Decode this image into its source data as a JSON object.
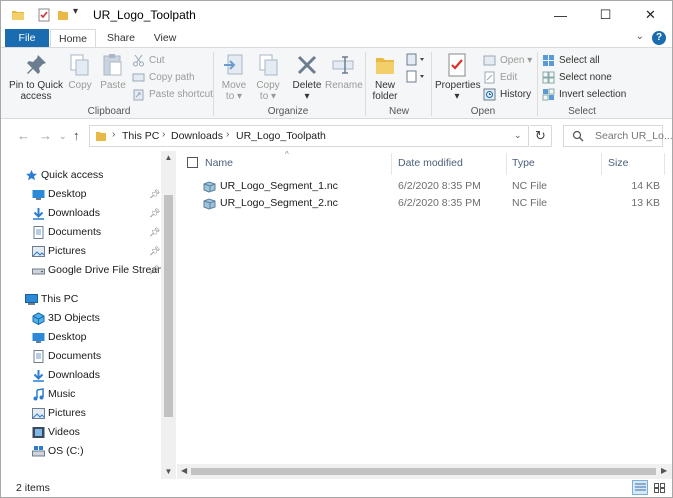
{
  "window": {
    "title": "UR_Logo_Toolpath",
    "controls": [
      "—",
      "☐",
      "✕"
    ]
  },
  "ribbon": {
    "tabs": [
      "File",
      "Home",
      "Share",
      "View"
    ],
    "clipboard": {
      "label": "Clipboard",
      "pin_line1": "Pin to Quick",
      "pin_line2": "access",
      "copy": "Copy",
      "paste": "Paste",
      "cut": "Cut",
      "copy_path": "Copy path",
      "paste_shortcut": "Paste shortcut"
    },
    "organize": {
      "label": "Organize",
      "move_line1": "Move",
      "move_line2": "to ▾",
      "copy_line1": "Copy",
      "copy_line2": "to ▾",
      "delete_line1": "Delete",
      "delete_line2": "▾",
      "rename": "Rename"
    },
    "new": {
      "label": "New",
      "folder_line1": "New",
      "folder_line2": "folder"
    },
    "open": {
      "label": "Open",
      "properties_line1": "Properties",
      "properties_line2": "▾",
      "open": "Open ▾",
      "edit": "Edit",
      "history": "History"
    },
    "select": {
      "label": "Select",
      "select_all": "Select all",
      "select_none": "Select none",
      "invert": "Invert selection"
    }
  },
  "address": {
    "crumbs": [
      "This PC",
      "Downloads",
      "UR_Logo_Toolpath"
    ],
    "search_placeholder": "Search UR_Lo..."
  },
  "nav_pane": {
    "quick_access": "Quick access",
    "quick_items": [
      "Desktop",
      "Downloads",
      "Documents",
      "Pictures",
      "Google Drive File Stream"
    ],
    "this_pc": "This PC",
    "pc_items": [
      "3D Objects",
      "Desktop",
      "Documents",
      "Downloads",
      "Music",
      "Pictures",
      "Videos",
      "OS (C:)"
    ]
  },
  "file_list": {
    "columns": [
      "Name",
      "Date modified",
      "Type",
      "Size"
    ],
    "rows": [
      {
        "name": "UR_Logo_Segment_1.nc",
        "date": "6/2/2020 8:35 PM",
        "type": "NC File",
        "size": "14 KB"
      },
      {
        "name": "UR_Logo_Segment_2.nc",
        "date": "6/2/2020 8:35 PM",
        "type": "NC File",
        "size": "13 KB"
      }
    ]
  },
  "status": {
    "count": "2 items"
  },
  "colors": {
    "file_tab": "#1a6cb0",
    "folder": "#e8b945",
    "accent_blue": "#1a6cb0"
  }
}
